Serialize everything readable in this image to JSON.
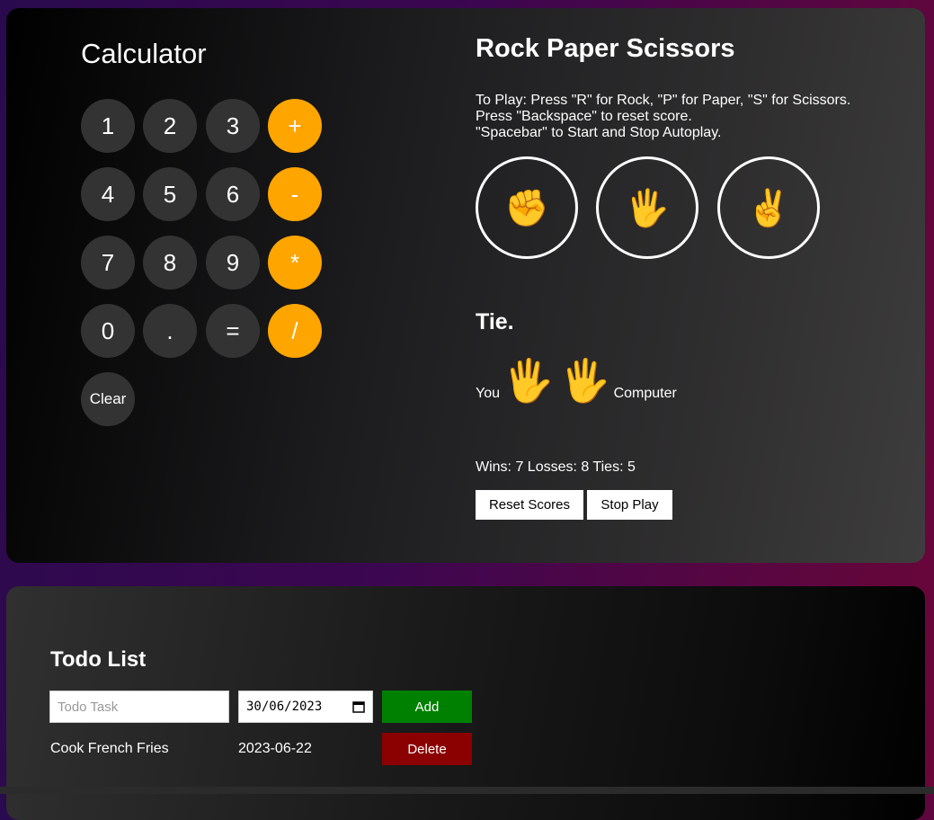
{
  "calculator": {
    "title": "Calculator",
    "buttons": [
      "1",
      "2",
      "3",
      "+",
      "4",
      "5",
      "6",
      "-",
      "7",
      "8",
      "9",
      "*",
      "0",
      ".",
      "=",
      "/",
      "Clear"
    ]
  },
  "rps": {
    "title": "Rock Paper Scissors",
    "instructions": [
      "To Play: Press \"R\" for Rock, \"P\" for Paper, \"S\" for Scissors.",
      "Press \"Backspace\" to reset score.",
      "\"Spacebar\" to Start and Stop Autoplay."
    ],
    "moves": [
      "✊",
      "🖐",
      "✌️"
    ],
    "result": "Tie.",
    "you_label": "You",
    "computer_label": "Computer",
    "you_pick": "🖐",
    "computer_pick": "🖐",
    "score": "Wins: 7 Losses: 8 Ties: 5",
    "reset_label": "Reset Scores",
    "autoplay_label": "Stop Play"
  },
  "todo": {
    "title": "Todo List",
    "placeholder": "Todo Task",
    "date_value": "30/06/2023",
    "add_label": "Add",
    "items": [
      {
        "name": "Cook French Fries",
        "date": "2023-06-22",
        "delete_label": "Delete"
      }
    ]
  },
  "colors": {
    "operator": "#ffa500",
    "number": "#333333",
    "add": "#008000",
    "delete": "#8b0000"
  },
  "icons": {
    "date_picker": "calendar-icon"
  }
}
